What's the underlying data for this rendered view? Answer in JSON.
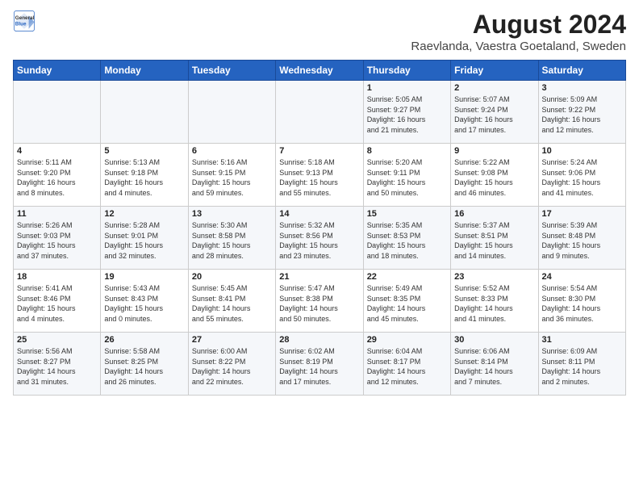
{
  "logo": {
    "line1": "General",
    "line2": "Blue"
  },
  "title": {
    "month_year": "August 2024",
    "location": "Raevlanda, Vaestra Goetaland, Sweden"
  },
  "days_of_week": [
    "Sunday",
    "Monday",
    "Tuesday",
    "Wednesday",
    "Thursday",
    "Friday",
    "Saturday"
  ],
  "weeks": [
    [
      {
        "day": "",
        "info": ""
      },
      {
        "day": "",
        "info": ""
      },
      {
        "day": "",
        "info": ""
      },
      {
        "day": "",
        "info": ""
      },
      {
        "day": "1",
        "info": "Sunrise: 5:05 AM\nSunset: 9:27 PM\nDaylight: 16 hours\nand 21 minutes."
      },
      {
        "day": "2",
        "info": "Sunrise: 5:07 AM\nSunset: 9:24 PM\nDaylight: 16 hours\nand 17 minutes."
      },
      {
        "day": "3",
        "info": "Sunrise: 5:09 AM\nSunset: 9:22 PM\nDaylight: 16 hours\nand 12 minutes."
      }
    ],
    [
      {
        "day": "4",
        "info": "Sunrise: 5:11 AM\nSunset: 9:20 PM\nDaylight: 16 hours\nand 8 minutes."
      },
      {
        "day": "5",
        "info": "Sunrise: 5:13 AM\nSunset: 9:18 PM\nDaylight: 16 hours\nand 4 minutes."
      },
      {
        "day": "6",
        "info": "Sunrise: 5:16 AM\nSunset: 9:15 PM\nDaylight: 15 hours\nand 59 minutes."
      },
      {
        "day": "7",
        "info": "Sunrise: 5:18 AM\nSunset: 9:13 PM\nDaylight: 15 hours\nand 55 minutes."
      },
      {
        "day": "8",
        "info": "Sunrise: 5:20 AM\nSunset: 9:11 PM\nDaylight: 15 hours\nand 50 minutes."
      },
      {
        "day": "9",
        "info": "Sunrise: 5:22 AM\nSunset: 9:08 PM\nDaylight: 15 hours\nand 46 minutes."
      },
      {
        "day": "10",
        "info": "Sunrise: 5:24 AM\nSunset: 9:06 PM\nDaylight: 15 hours\nand 41 minutes."
      }
    ],
    [
      {
        "day": "11",
        "info": "Sunrise: 5:26 AM\nSunset: 9:03 PM\nDaylight: 15 hours\nand 37 minutes."
      },
      {
        "day": "12",
        "info": "Sunrise: 5:28 AM\nSunset: 9:01 PM\nDaylight: 15 hours\nand 32 minutes."
      },
      {
        "day": "13",
        "info": "Sunrise: 5:30 AM\nSunset: 8:58 PM\nDaylight: 15 hours\nand 28 minutes."
      },
      {
        "day": "14",
        "info": "Sunrise: 5:32 AM\nSunset: 8:56 PM\nDaylight: 15 hours\nand 23 minutes."
      },
      {
        "day": "15",
        "info": "Sunrise: 5:35 AM\nSunset: 8:53 PM\nDaylight: 15 hours\nand 18 minutes."
      },
      {
        "day": "16",
        "info": "Sunrise: 5:37 AM\nSunset: 8:51 PM\nDaylight: 15 hours\nand 14 minutes."
      },
      {
        "day": "17",
        "info": "Sunrise: 5:39 AM\nSunset: 8:48 PM\nDaylight: 15 hours\nand 9 minutes."
      }
    ],
    [
      {
        "day": "18",
        "info": "Sunrise: 5:41 AM\nSunset: 8:46 PM\nDaylight: 15 hours\nand 4 minutes."
      },
      {
        "day": "19",
        "info": "Sunrise: 5:43 AM\nSunset: 8:43 PM\nDaylight: 15 hours\nand 0 minutes."
      },
      {
        "day": "20",
        "info": "Sunrise: 5:45 AM\nSunset: 8:41 PM\nDaylight: 14 hours\nand 55 minutes."
      },
      {
        "day": "21",
        "info": "Sunrise: 5:47 AM\nSunset: 8:38 PM\nDaylight: 14 hours\nand 50 minutes."
      },
      {
        "day": "22",
        "info": "Sunrise: 5:49 AM\nSunset: 8:35 PM\nDaylight: 14 hours\nand 45 minutes."
      },
      {
        "day": "23",
        "info": "Sunrise: 5:52 AM\nSunset: 8:33 PM\nDaylight: 14 hours\nand 41 minutes."
      },
      {
        "day": "24",
        "info": "Sunrise: 5:54 AM\nSunset: 8:30 PM\nDaylight: 14 hours\nand 36 minutes."
      }
    ],
    [
      {
        "day": "25",
        "info": "Sunrise: 5:56 AM\nSunset: 8:27 PM\nDaylight: 14 hours\nand 31 minutes."
      },
      {
        "day": "26",
        "info": "Sunrise: 5:58 AM\nSunset: 8:25 PM\nDaylight: 14 hours\nand 26 minutes."
      },
      {
        "day": "27",
        "info": "Sunrise: 6:00 AM\nSunset: 8:22 PM\nDaylight: 14 hours\nand 22 minutes."
      },
      {
        "day": "28",
        "info": "Sunrise: 6:02 AM\nSunset: 8:19 PM\nDaylight: 14 hours\nand 17 minutes."
      },
      {
        "day": "29",
        "info": "Sunrise: 6:04 AM\nSunset: 8:17 PM\nDaylight: 14 hours\nand 12 minutes."
      },
      {
        "day": "30",
        "info": "Sunrise: 6:06 AM\nSunset: 8:14 PM\nDaylight: 14 hours\nand 7 minutes."
      },
      {
        "day": "31",
        "info": "Sunrise: 6:09 AM\nSunset: 8:11 PM\nDaylight: 14 hours\nand 2 minutes."
      }
    ]
  ]
}
